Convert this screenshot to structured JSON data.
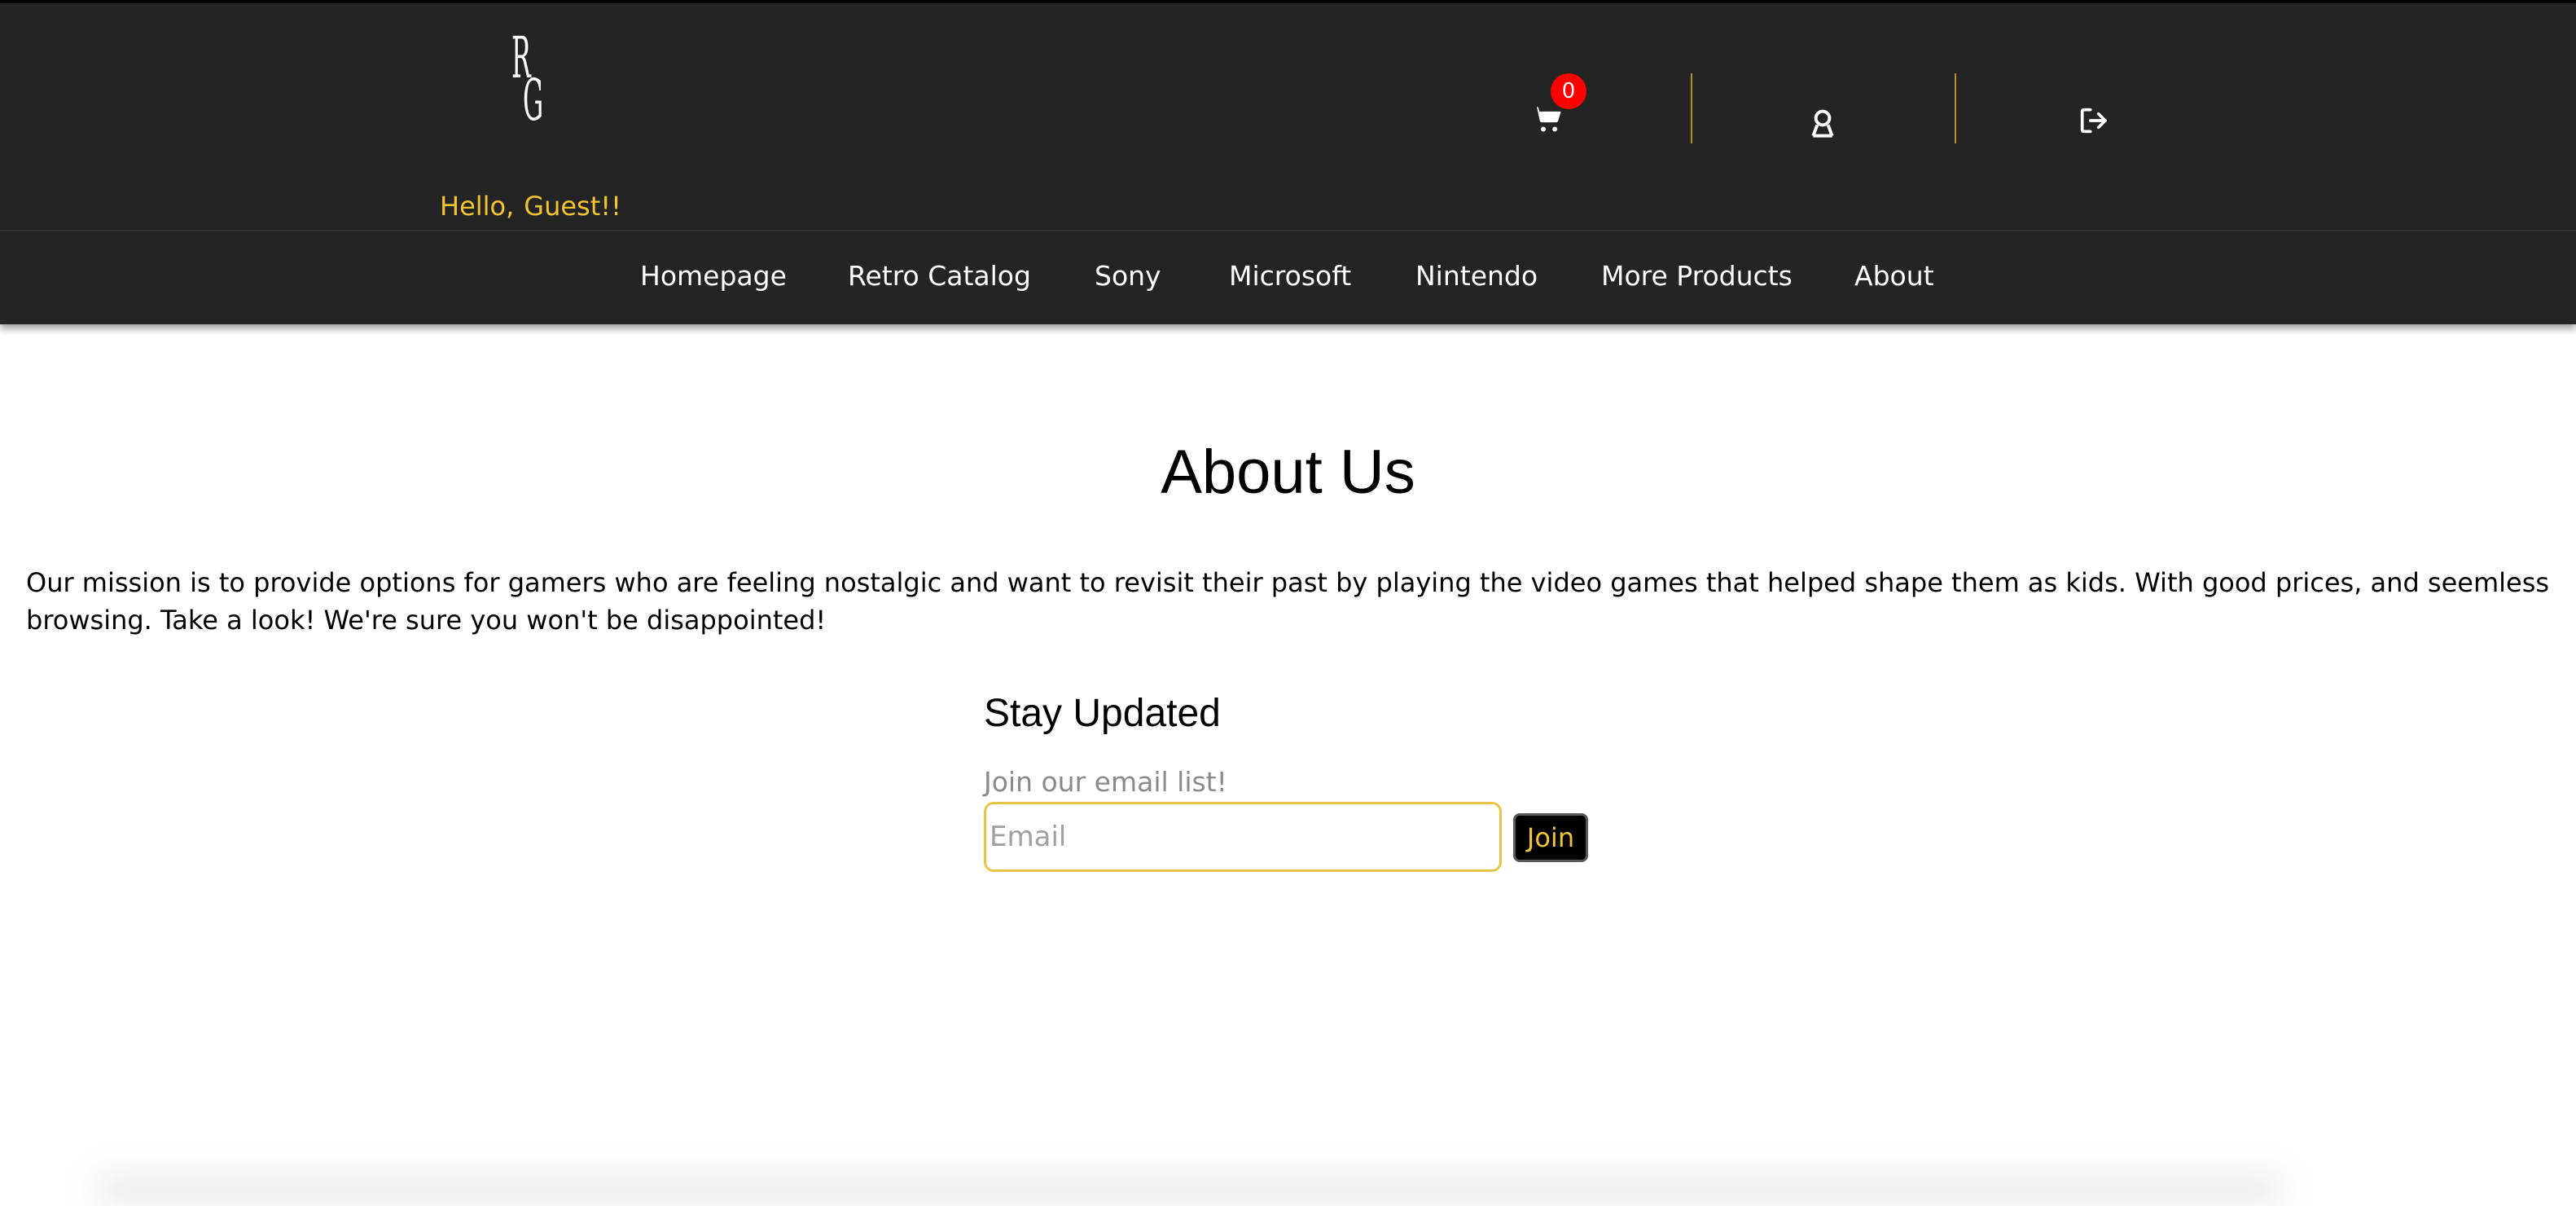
{
  "header": {
    "logo_letters": "RG",
    "greeting": "Hello,",
    "guest_name": "Guest!!",
    "cart_count": "0",
    "accent_color": "#f2c430",
    "divider_color": "#b8921c",
    "badge_color": "#ff0000",
    "icons": [
      "cart-icon",
      "user-icon",
      "logout-icon"
    ]
  },
  "nav": {
    "items": [
      "Homepage",
      "Retro Catalog",
      "Sony",
      "Microsoft",
      "Nintendo",
      "More Products",
      "About"
    ]
  },
  "main": {
    "title": "About Us",
    "mission": "Our mission is to provide options for gamers who are feeling nostalgic and want to revisit their past by playing the video games that helped shape them as kids. With good prices, and seemless browsing. Take a look! We're sure you won't be disappointed!",
    "newsletter": {
      "heading": "Stay Updated",
      "label": "Join our email list!",
      "email_placeholder": "Email",
      "email_value": "",
      "button": "Join"
    }
  }
}
